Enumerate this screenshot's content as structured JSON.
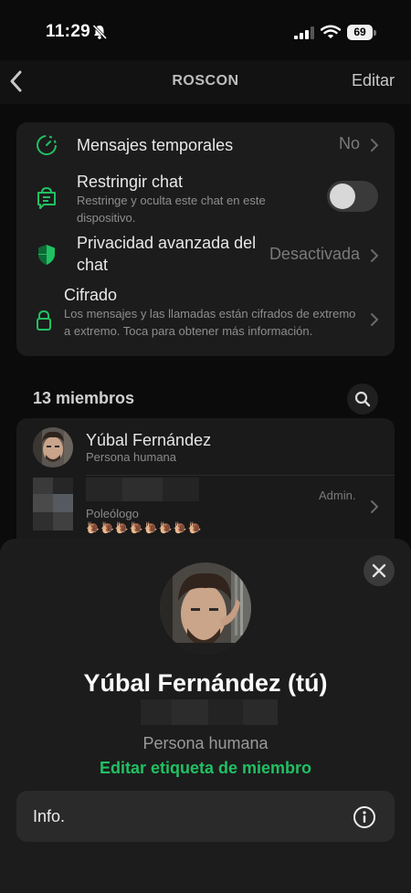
{
  "status_bar": {
    "time": "11:29",
    "battery": "69"
  },
  "nav": {
    "title": "ROSCON",
    "edit_label": "Editar"
  },
  "settings": [
    {
      "label": "Mensajes temporales",
      "value": "No"
    },
    {
      "label": "Restringir chat",
      "description": "Restringe y oculta este chat en este dispositivo.",
      "toggle_on": false
    },
    {
      "label": "Privacidad avanzada del chat",
      "value": "Desactivada"
    },
    {
      "label": "Cifrado",
      "description": "Los mensajes y las llamadas están cifrados de extremo a extremo. Toca para obtener más información."
    }
  ],
  "members": {
    "count_label": "13 miembros",
    "list": [
      {
        "name": "Yúbal Fernández",
        "tag": "Persona humana"
      },
      {
        "tag": "Poleólogo",
        "badge": "Admin.",
        "emoji": "🐌🐌🐌🐌🐌🐌🐌🐌"
      }
    ]
  },
  "sheet": {
    "name": "Yúbal Fernández (tú)",
    "tag": "Persona humana",
    "edit_label": "Editar etiqueta de miembro",
    "info_label": "Info."
  },
  "colors": {
    "accent": "#21c063",
    "background": "#0b0b0b",
    "card": "#1c1c1c"
  },
  "icons": [
    "bell-off-icon",
    "signal-icon",
    "wifi-icon",
    "battery-icon",
    "back-chevron-icon",
    "timer-icon",
    "chat-lock-icon",
    "shield-icon",
    "lock-icon",
    "chevron-right-icon",
    "search-icon",
    "close-icon",
    "info-icon"
  ]
}
